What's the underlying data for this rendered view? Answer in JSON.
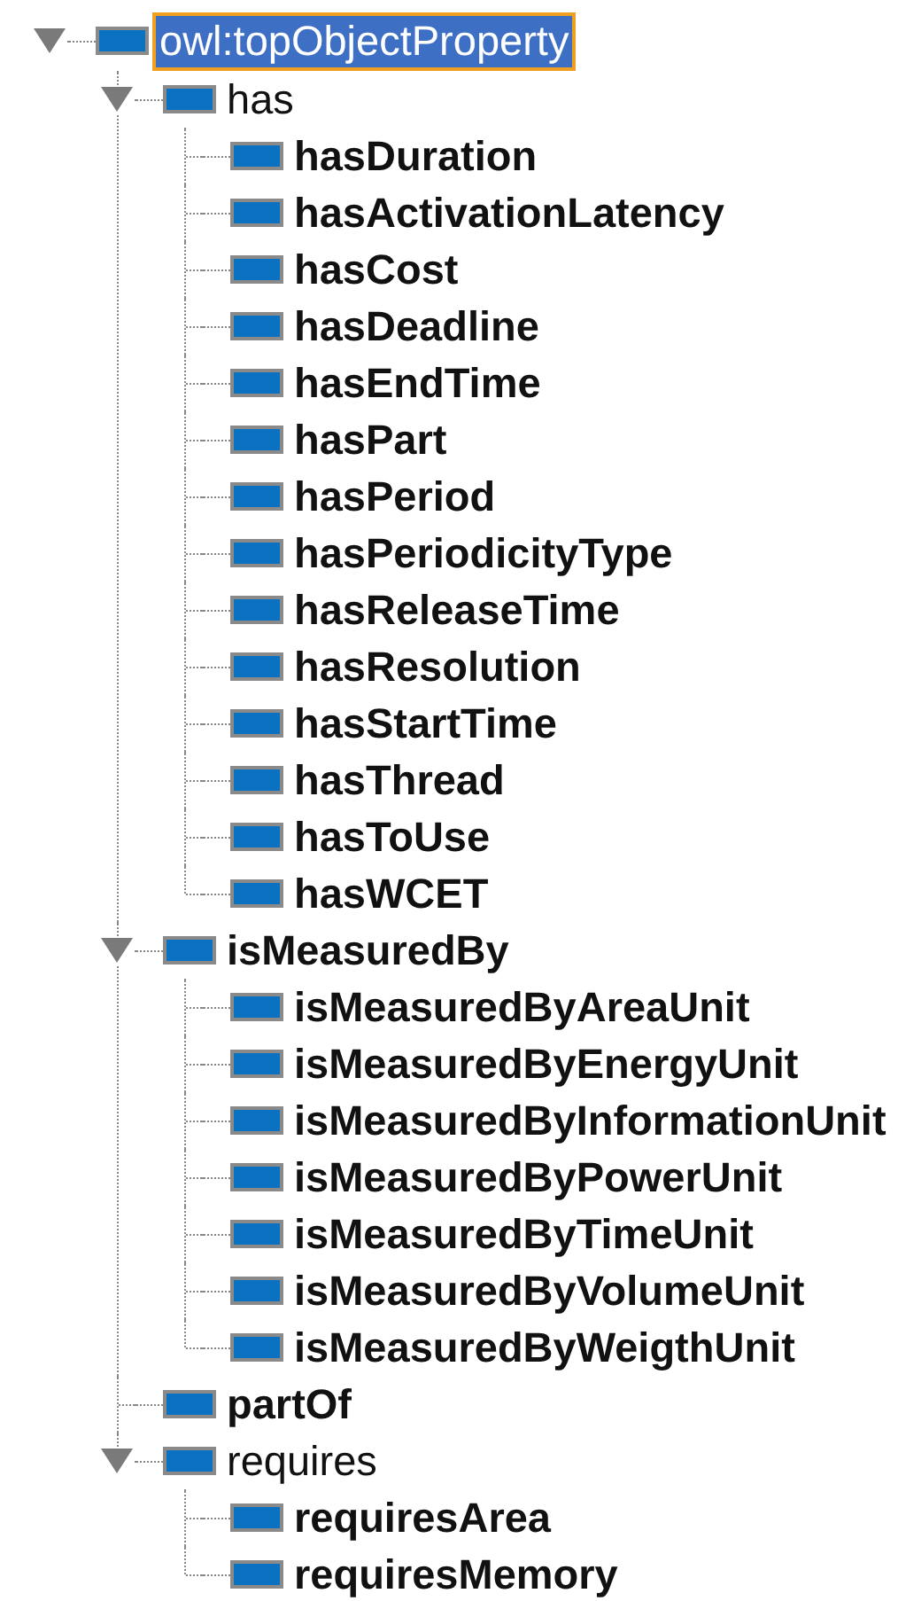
{
  "tree": [
    {
      "label": "owl:topObjectProperty",
      "bold": false,
      "selected": true,
      "expanded": true,
      "children": [
        {
          "label": "has",
          "bold": false,
          "selected": false,
          "expanded": true,
          "children": [
            {
              "label": "hasDuration",
              "bold": true,
              "selected": false
            },
            {
              "label": "hasActivationLatency",
              "bold": true,
              "selected": false
            },
            {
              "label": "hasCost",
              "bold": true,
              "selected": false
            },
            {
              "label": "hasDeadline",
              "bold": true,
              "selected": false
            },
            {
              "label": "hasEndTime",
              "bold": true,
              "selected": false
            },
            {
              "label": "hasPart",
              "bold": true,
              "selected": false
            },
            {
              "label": "hasPeriod",
              "bold": true,
              "selected": false
            },
            {
              "label": "hasPeriodicityType",
              "bold": true,
              "selected": false
            },
            {
              "label": "hasReleaseTime",
              "bold": true,
              "selected": false
            },
            {
              "label": "hasResolution",
              "bold": true,
              "selected": false
            },
            {
              "label": "hasStartTime",
              "bold": true,
              "selected": false
            },
            {
              "label": "hasThread",
              "bold": true,
              "selected": false
            },
            {
              "label": "hasToUse",
              "bold": true,
              "selected": false
            },
            {
              "label": "hasWCET",
              "bold": true,
              "selected": false
            }
          ]
        },
        {
          "label": "isMeasuredBy",
          "bold": true,
          "selected": false,
          "expanded": true,
          "children": [
            {
              "label": "isMeasuredByAreaUnit",
              "bold": true,
              "selected": false
            },
            {
              "label": "isMeasuredByEnergyUnit",
              "bold": true,
              "selected": false
            },
            {
              "label": "isMeasuredByInformationUnit",
              "bold": true,
              "selected": false
            },
            {
              "label": "isMeasuredByPowerUnit",
              "bold": true,
              "selected": false
            },
            {
              "label": "isMeasuredByTimeUnit",
              "bold": true,
              "selected": false
            },
            {
              "label": "isMeasuredByVolumeUnit",
              "bold": true,
              "selected": false
            },
            {
              "label": "isMeasuredByWeigthUnit",
              "bold": true,
              "selected": false
            }
          ]
        },
        {
          "label": "partOf",
          "bold": true,
          "selected": false
        },
        {
          "label": "requires",
          "bold": false,
          "selected": false,
          "expanded": true,
          "children": [
            {
              "label": "requiresArea",
              "bold": true,
              "selected": false
            },
            {
              "label": "requiresMemory",
              "bold": true,
              "selected": false
            }
          ]
        }
      ]
    }
  ]
}
